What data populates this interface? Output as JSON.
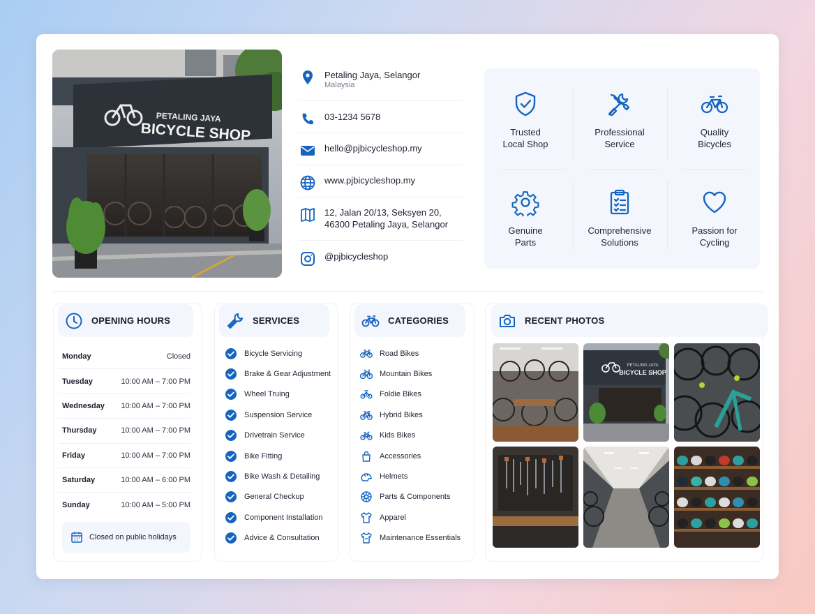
{
  "hero": {
    "sign_line1": "PETALING JAYA",
    "sign_line2": "BICYCLE SHOP"
  },
  "contacts": {
    "location": "Petaling Jaya, Selangor",
    "country": "Malaysia",
    "phone": "03-1234 5678",
    "email": "hello@pjbicycleshop.my",
    "website": "www.pjbicycleshop.my",
    "address_line1": "12, Jalan 20/13, Seksyen 20,",
    "address_line2": "46300 Petaling Jaya, Selangor",
    "instagram": "@pjbicycleshop"
  },
  "features": [
    {
      "icon": "shield-check-icon",
      "label": "Trusted\nLocal Shop"
    },
    {
      "icon": "tools-icon",
      "label": "Professional\nService"
    },
    {
      "icon": "bicycle-icon",
      "label": "Quality\nBicycles"
    },
    {
      "icon": "gear-icon",
      "label": "Genuine\nParts"
    },
    {
      "icon": "clipboard-icon",
      "label": "Comprehensive\nSolutions"
    },
    {
      "icon": "heart-icon",
      "label": "Passion for\nCycling"
    }
  ],
  "opening_hours": {
    "title": "OPENING HOURS",
    "rows": [
      {
        "day": "Monday",
        "time": "Closed"
      },
      {
        "day": "Tuesday",
        "time": "10:00 AM – 7:00 PM"
      },
      {
        "day": "Wednesday",
        "time": "10:00 AM – 7:00 PM"
      },
      {
        "day": "Thursday",
        "time": "10:00 AM – 7:00 PM"
      },
      {
        "day": "Friday",
        "time": "10:00 AM – 7:00 PM"
      },
      {
        "day": "Saturday",
        "time": "10:00 AM – 6:00 PM"
      },
      {
        "day": "Sunday",
        "time": "10:00 AM – 5:00 PM"
      }
    ],
    "note": "Closed on public holidays"
  },
  "services": {
    "title": "SERVICES",
    "items": [
      "Bicycle Servicing",
      "Brake & Gear Adjustment",
      "Wheel Truing",
      "Suspension Service",
      "Drivetrain Service",
      "Bike Fitting",
      "Bike Wash & Detailing",
      "General Checkup",
      "Component Installation",
      "Advice & Consultation"
    ]
  },
  "categories": {
    "title": "CATEGORIES",
    "items": [
      {
        "icon": "bicycle-icon",
        "label": "Road Bikes"
      },
      {
        "icon": "bicycle-icon",
        "label": "Mountain Bikes"
      },
      {
        "icon": "bicycle-icon",
        "label": "Foldie Bikes"
      },
      {
        "icon": "bicycle-icon",
        "label": "Hybrid Bikes"
      },
      {
        "icon": "bicycle-icon",
        "label": "Kids Bikes"
      },
      {
        "icon": "bag-icon",
        "label": "Accessories"
      },
      {
        "icon": "helmet-icon",
        "label": "Helmets"
      },
      {
        "icon": "parts-icon",
        "label": "Parts & Components"
      },
      {
        "icon": "shirt-icon",
        "label": "Apparel"
      },
      {
        "icon": "shirt-icon",
        "label": "Maintenance Essentials"
      }
    ]
  },
  "photos": {
    "title": "RECENT PHOTOS",
    "photo1_sign_line1": "PETALING JAYA",
    "photo1_sign_line2": "BICYCLE SHOP"
  },
  "colors": {
    "accent": "#1565c0",
    "panel_bg": "#f3f6fc",
    "border": "#edf0f5"
  }
}
